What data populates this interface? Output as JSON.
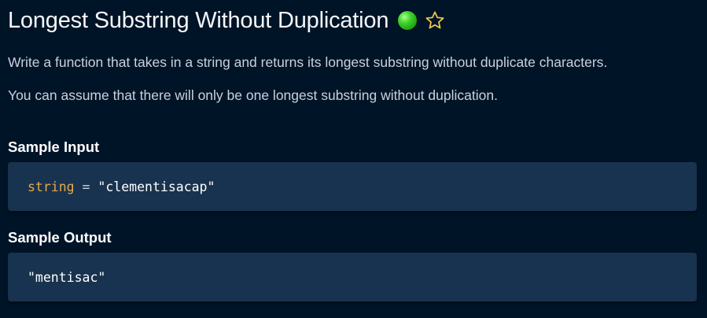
{
  "problem": {
    "title": "Longest Substring Without Duplication",
    "difficulty_color": "#2fcb1f",
    "favorite_icon": "star-outline-icon",
    "favorite_color": "#f2c94c"
  },
  "description": {
    "paragraphs": [
      "Write a function that takes in a string and returns its longest substring without duplicate characters.",
      "You can assume that there will only be one longest substring without duplication."
    ]
  },
  "sample_input": {
    "heading": "Sample Input",
    "variable": "string",
    "operator": " = ",
    "value": "\"clementisacap\""
  },
  "sample_output": {
    "heading": "Sample Output",
    "value": "\"mentisac\""
  },
  "colors": {
    "background": "#001427",
    "code_background": "#18334f",
    "code_variable": "#e9a84a"
  }
}
